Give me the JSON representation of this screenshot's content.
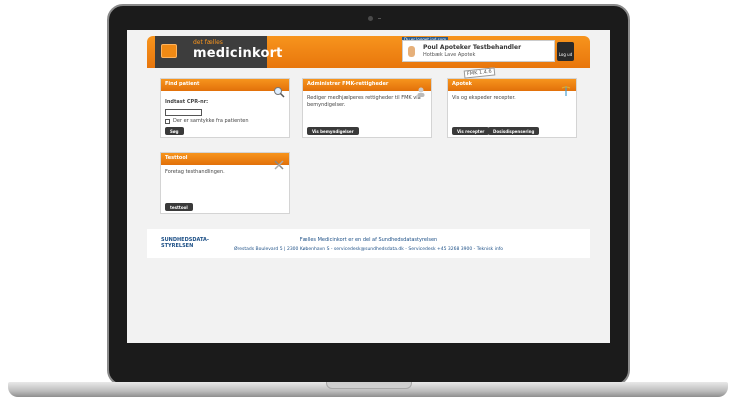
{
  "header": {
    "logo_small": "det fælles",
    "logo_main": "medicinkort",
    "login_tag": "Du er logget ind som",
    "user_name": "Poul Apoteker Testbehandler",
    "user_location": "Hotbæk Lave Apotek",
    "logout_label": "Log ud"
  },
  "panels": {
    "find_patient": {
      "title": "Find patient",
      "cpr_label": "Indtast CPR-nr:",
      "cpr_value": "",
      "consent_label": "Der er samtykke fra patienten",
      "button": "Søg"
    },
    "fmk_rights": {
      "title": "Administrer FMK-rettigheder",
      "description": "Rediger medhjælperes rettigheder til FMK via bemyndigelser.",
      "button": "Vis bemyndigelser"
    },
    "apotek": {
      "title": "Apotek",
      "badge": "FMK 1.4.6",
      "description": "Vis og ekspeder recepter.",
      "button1": "Vis recepter",
      "button2": "Dosisdispensering"
    },
    "testtool": {
      "title": "Testtool",
      "description": "Foretag testhandlingen.",
      "button": "testtool"
    }
  },
  "footer": {
    "logo_line1": "SUNDHEDSDATA-",
    "logo_line2": "STYRELSEN",
    "text1": "Fælles Medicinkort er en del af Sundhedsdatastyrelsen",
    "text2": "Ørestads Boulevard 5 | 2300 København S - servicedesk@sundhedsdata.dk - Servicedesk +45 3268 3900 - Teknisk info"
  },
  "colors": {
    "accent": "#f7941d",
    "dark": "#3a3a3a",
    "link": "#1c4f86"
  }
}
